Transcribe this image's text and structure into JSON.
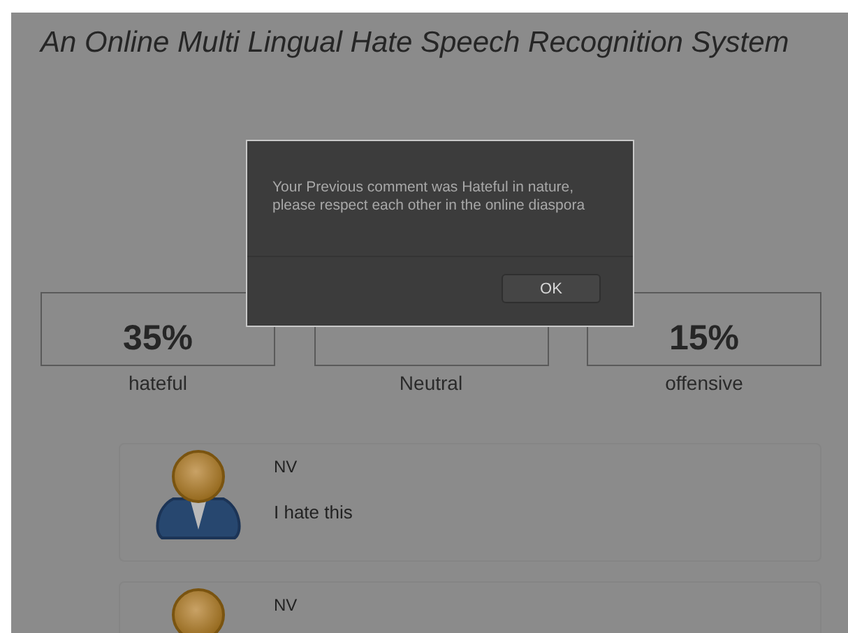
{
  "page": {
    "title": "An Online Multi Lingual Hate Speech Recognition System"
  },
  "stats": [
    {
      "value": "35%",
      "label": "hateful"
    },
    {
      "label": "Neutral"
    },
    {
      "value": "15%",
      "label": "offensive"
    }
  ],
  "comments": [
    {
      "author": "NV",
      "text": "I hate this"
    },
    {
      "author": "NV"
    }
  ],
  "dialog": {
    "message": "Your Previous comment was Hateful in nature, please respect each other in the online diaspora",
    "buttons": [
      "OK"
    ]
  }
}
